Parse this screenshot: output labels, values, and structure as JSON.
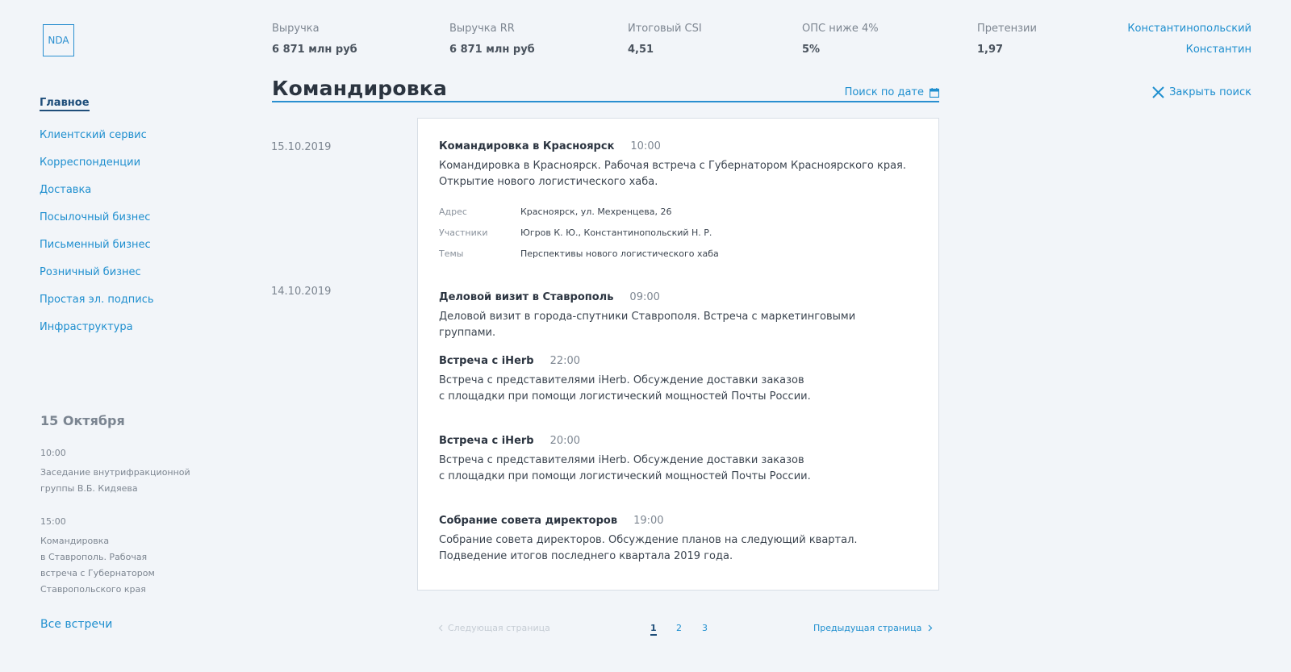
{
  "logo": {
    "text": "NDA"
  },
  "nav": {
    "items": [
      {
        "label": "Главное",
        "active": true
      },
      {
        "label": "Клиентский сервис"
      },
      {
        "label": "Корреспонденции"
      },
      {
        "label": "Доставка"
      },
      {
        "label": "Посылочный бизнес"
      },
      {
        "label": "Письменный бизнес"
      },
      {
        "label": "Розничный бизнес"
      },
      {
        "label": "Простая эл. подпись"
      },
      {
        "label": "Инфраструктура"
      }
    ]
  },
  "day": {
    "title": "15 Октября",
    "entries": [
      {
        "time": "10:00",
        "lines": [
          "Заседание внутрифракционной",
          "группы В.Б. Кидяева"
        ]
      },
      {
        "time": "15:00",
        "lines": [
          "Командировка",
          "в Ставрополь. Рабочая",
          "встреча с Губернатором",
          "Ставропольского края"
        ]
      }
    ],
    "all_link": "Все встречи"
  },
  "kpis": [
    {
      "label": "Выручка",
      "value": "6 871 млн руб"
    },
    {
      "label": "Выручка RR",
      "value": "6 871 млн руб"
    },
    {
      "label": "Итоговый CSI",
      "value": "4,51"
    },
    {
      "label": "ОПС ниже 4%",
      "value": "5%"
    },
    {
      "label": "Претензии",
      "value": "1,97"
    }
  ],
  "user": {
    "last_name": "Константинопольский",
    "first_name": "Константин"
  },
  "header": {
    "title": "Командировка",
    "date_search": "Поиск по дате",
    "close_search": "Закрыть поиск"
  },
  "dates": [
    "15.10.2019",
    "14.10.2019"
  ],
  "events": [
    {
      "title": "Командировка в Красноярск",
      "time": "10:00",
      "desc_lines": [
        "Командировка в Красноярск. Рабочая встреча с Губернатором Красноярского края.",
        "Открытие нового логистического хаба."
      ],
      "props": [
        {
          "k": "Адрес",
          "v": "Красноярск, ул. Мехренцева, 26"
        },
        {
          "k": "Участники",
          "v": "Югров К. Ю., Константинопольский Н. Р."
        },
        {
          "k": "Темы",
          "v": "Перспективы нового логистического хаба"
        }
      ]
    },
    {
      "title": "Деловой визит в Ставрополь",
      "time": "09:00",
      "desc_lines": [
        "Деловой визит в города-спутники Ставрополя. Встреча с маркетинговыми группами."
      ]
    },
    {
      "title": "Встреча с iHerb",
      "time": "22:00",
      "desc_lines": [
        "Встреча с представителями iHerb. Обсуждение доставки заказов",
        "с площадки при помощи логистический мощностей Почты России."
      ]
    },
    {
      "title": "Встреча с iHerb",
      "time": "20:00",
      "desc_lines": [
        "Встреча с представителями iHerb. Обсуждение доставки заказов",
        "с площадки при помощи логистический мощностей Почты России."
      ]
    },
    {
      "title": "Собрание совета директоров",
      "time": "19:00",
      "desc_lines": [
        "Собрание совета директоров. Обсуждение планов на следующий квартал.",
        "Подведение итогов последнего квартала 2019 года."
      ]
    }
  ],
  "pagination": {
    "prev": "Следующая страница",
    "next": "Предыдущая страница",
    "pages": [
      "1",
      "2",
      "3"
    ],
    "current": "1"
  },
  "colors": {
    "accent": "#1f8fcf",
    "active": "#1f4e7a",
    "background": "#f2f5f9"
  }
}
